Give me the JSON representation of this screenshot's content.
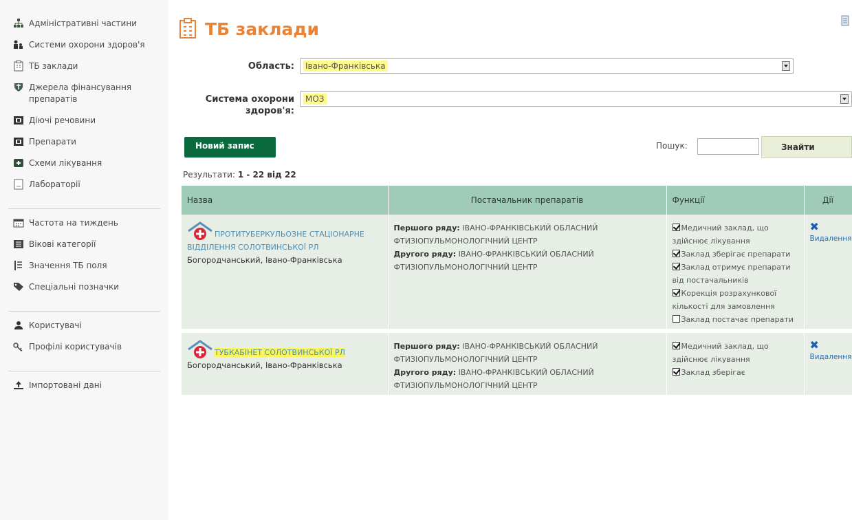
{
  "sidebar": {
    "groups": [
      {
        "items": [
          {
            "label": "Адміністративні частини",
            "icon": "org-chart-icon"
          },
          {
            "label": "Системи охорони здоров'я",
            "icon": "people-tree-icon"
          },
          {
            "label": "ТБ заклади",
            "icon": "building-icon"
          },
          {
            "label": "Джерела фінансування препаратів",
            "icon": "shield-icon"
          },
          {
            "label": "Діючі речовини",
            "icon": "substance-icon"
          },
          {
            "label": "Препарати",
            "icon": "medicine-icon"
          },
          {
            "label": "Схеми лікування",
            "icon": "schema-icon"
          },
          {
            "label": "Лабораторії",
            "icon": "lab-icon"
          }
        ]
      },
      {
        "items": [
          {
            "label": "Частота на тиждень",
            "icon": "calendar-icon"
          },
          {
            "label": "Вікові категорії",
            "icon": "list-icon"
          },
          {
            "label": "Значення ТБ поля",
            "icon": "values-icon"
          },
          {
            "label": "Спеціальні позначки",
            "icon": "tag-icon"
          }
        ]
      },
      {
        "items": [
          {
            "label": "Користувачі",
            "icon": "user-icon"
          },
          {
            "label": "Профілі користувачів",
            "icon": "key-icon"
          }
        ]
      },
      {
        "items": [
          {
            "label": "Імпортовані дані",
            "icon": "import-icon"
          }
        ]
      }
    ]
  },
  "page": {
    "title": "ТБ заклади",
    "title_icon": "building-icon",
    "corner_icon": "print-icon"
  },
  "filters": {
    "oblast_label": "Область:",
    "oblast_value": "Івано-Франківська",
    "system_label": "Система охорони здоров'я:",
    "system_value": "МОЗ"
  },
  "toolbar": {
    "new_record": "Новий запис",
    "search_label": "Пошук:",
    "search_value": "",
    "search_button": "Знайти"
  },
  "results": {
    "label": "Результати:",
    "range": "1 - 22 від 22"
  },
  "table": {
    "headers": [
      "Назва",
      "Постачальник препаратів",
      "Функції",
      "Дії"
    ],
    "rows": [
      {
        "name": "ПРОТИТУБЕРКУЛЬОЗНЕ СТАЦІОНАРНЕ ВІДДІЛЕННЯ СОЛОТВИНСЬКОЇ РЛ",
        "location": "Богородчанський, Івано-Франківська",
        "supplier_first_label": "Першого ряду:",
        "supplier_first": "ІВАНО-ФРАНКІВСЬКИЙ ОБЛАСНИЙ ФТИЗІОПУЛЬМОНОЛОГІЧНИЙ ЦЕНТР",
        "supplier_second_label": "Другого ряду:",
        "supplier_second": "ІВАНО-ФРАНКІВСЬКИЙ ОБЛАСНИЙ ФТИЗІОПУЛЬМОНОЛОГІЧНИЙ ЦЕНТР",
        "functions": [
          {
            "label": "Медичний заклад, що здійснює лікування",
            "checked": true
          },
          {
            "label": "Заклад зберігає препарати",
            "checked": true
          },
          {
            "label": "Заклад отримує препарати від постачальників",
            "checked": true
          },
          {
            "label": "Корекція розрахункової кількості для замовлення",
            "checked": true
          },
          {
            "label": "Заклад постачає препарати",
            "checked": false
          }
        ],
        "action": "Видалення"
      },
      {
        "name": "ТУБКАБІНЕТ СОЛОТВИНСЬКОЇ РЛ",
        "location": "Богородчанський, Івано-Франківська",
        "supplier_first_label": "Першого ряду:",
        "supplier_first": "ІВАНО-ФРАНКІВСЬКИЙ ОБЛАСНИЙ ФТИЗІОПУЛЬМОНОЛОГІЧНИЙ ЦЕНТР",
        "supplier_second_label": "Другого ряду:",
        "supplier_second": "ІВАНО-ФРАНКІВСЬКИЙ ОБЛАСНИЙ ФТИЗІОПУЛЬМОНОЛОГІЧНИЙ ЦЕНТР",
        "functions": [
          {
            "label": "Медичний заклад, що здійснює лікування",
            "checked": true
          },
          {
            "label": "Заклад зберігає",
            "checked": true
          }
        ],
        "action": "Видалення"
      }
    ]
  }
}
